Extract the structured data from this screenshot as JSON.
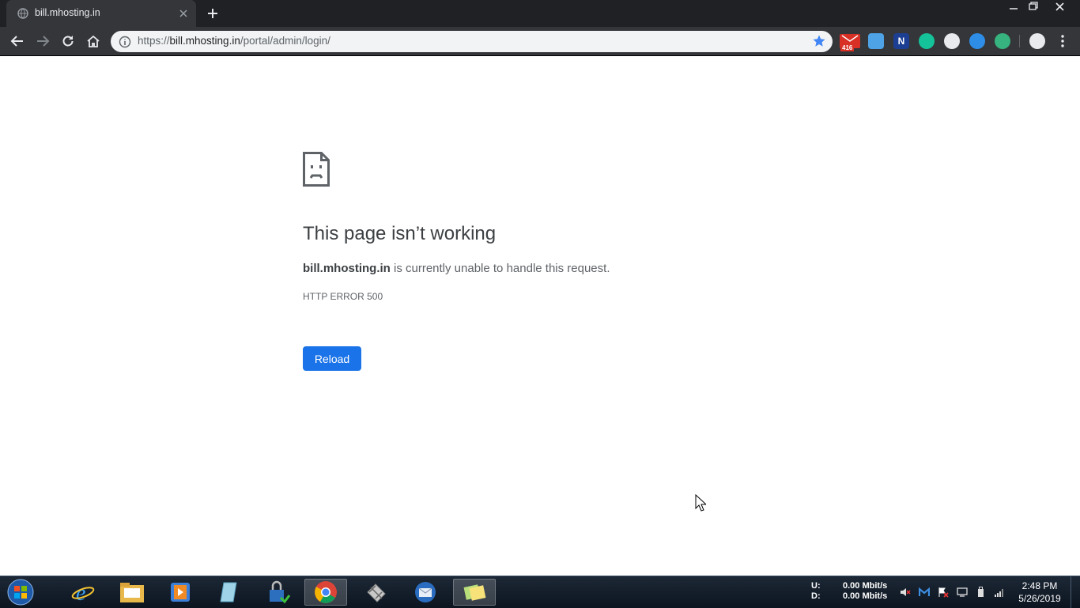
{
  "browser": {
    "tab": {
      "title": "bill.mhosting.in"
    },
    "address": {
      "scheme": "https://",
      "host": "bill.mhosting.in",
      "path": "/portal/admin/login/"
    },
    "extensions": {
      "mail_badge": "416",
      "notion_letter": "N"
    }
  },
  "page": {
    "heading": "This page isn’t working",
    "host": "bill.mhosting.in",
    "message": " is currently unable to handle this request.",
    "error_code": "HTTP ERROR 500",
    "reload_label": "Reload"
  },
  "taskbar": {
    "upload_label": "U:",
    "upload_value": "0.00 Mbit/s",
    "download_label": "D:",
    "download_value": "0.00 Mbit/s",
    "time": "2:48 PM",
    "date": "5/26/2019"
  },
  "colors": {
    "accent": "#1a73e8",
    "chrome_dark": "#202124",
    "toolbar": "#35363a"
  }
}
